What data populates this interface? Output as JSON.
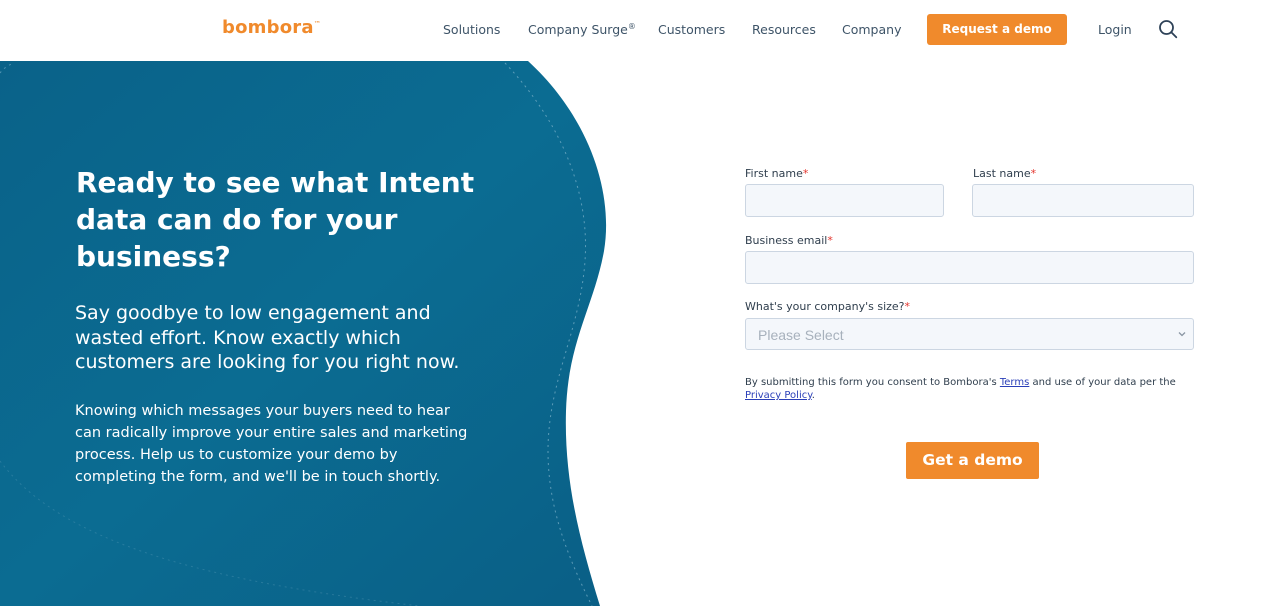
{
  "header": {
    "logo": "bombora",
    "nav": [
      "Solutions",
      "Company Surge",
      "Customers",
      "Resources",
      "Company"
    ],
    "surge_mark": "®",
    "cta": "Request a demo",
    "login": "Login",
    "search_icon": "search-icon"
  },
  "hero": {
    "title": "Ready to see what Intent data can do for your business?",
    "subtitle": "Say goodbye to low engagement and wasted effort. Know exactly which customers are looking for you right now.",
    "body": "Knowing which messages your buyers need to hear can radically improve your entire sales and marketing process. Help us to customize your demo by completing the form, and we'll be in touch shortly."
  },
  "form": {
    "first_name_label": "First name",
    "last_name_label": "Last name",
    "email_label": "Business email",
    "company_size_label": "What's your company's size?",
    "required_mark": "*",
    "first_name_value": "",
    "last_name_value": "",
    "email_value": "",
    "company_size_placeholder": "Please Select",
    "consent_prefix": "By submitting this form you consent to Bombora's ",
    "terms_link": "Terms",
    "consent_middle": " and use of your data per the ",
    "privacy_link": "Privacy Policy",
    "consent_suffix": ".",
    "submit": "Get a demo"
  },
  "colors": {
    "brand_orange": "#f08a2c",
    "hero_blue": "#0b6c91",
    "required_red": "#e4362f",
    "link_blue": "#2a3fb8"
  }
}
